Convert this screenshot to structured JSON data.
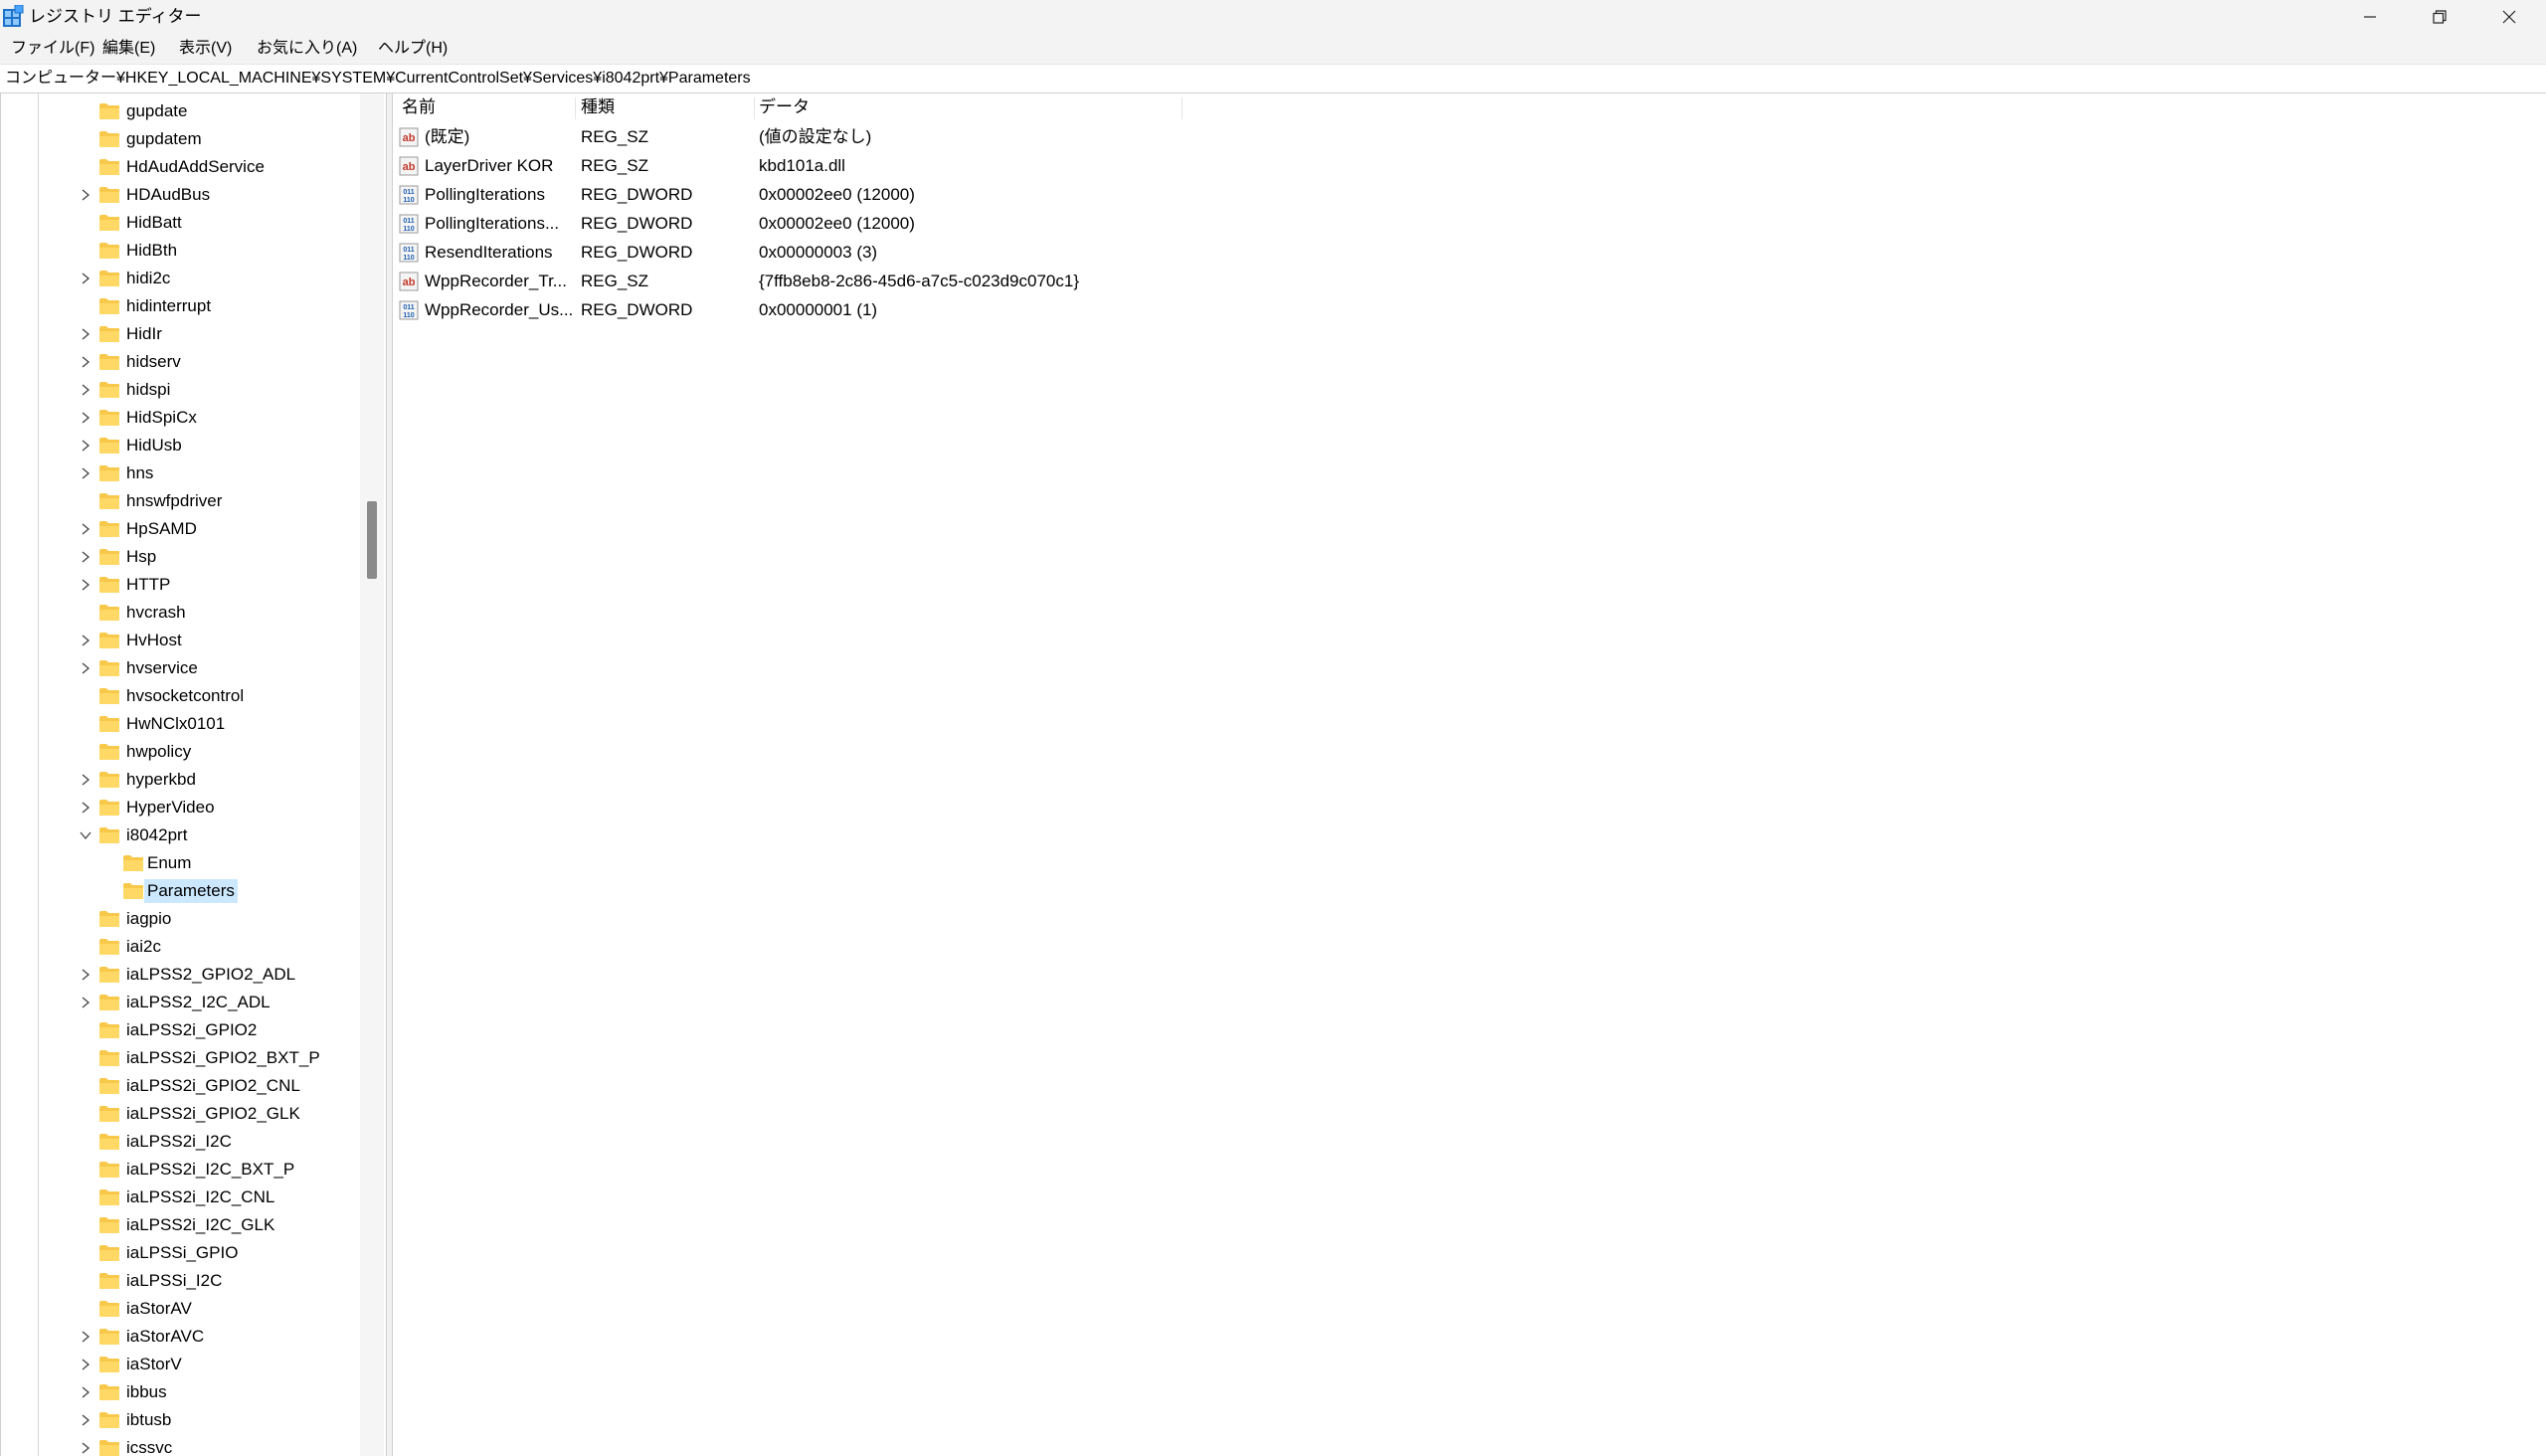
{
  "window": {
    "title": "レジストリ エディター",
    "controls": {
      "minimize": "─",
      "maximize": "❐",
      "close": "✕"
    }
  },
  "menu": [
    "ファイル(F)",
    "編集(E)",
    "表示(V)",
    "お気に入り(A)",
    "ヘルプ(H)"
  ],
  "address": "コンピューター¥HKEY_LOCAL_MACHINE¥SYSTEM¥CurrentControlSet¥Services¥i8042prt¥Parameters",
  "tree": {
    "items": [
      {
        "label": "gupdate",
        "level": 0,
        "chevron": "none"
      },
      {
        "label": "gupdatem",
        "level": 0,
        "chevron": "none"
      },
      {
        "label": "HdAudAddService",
        "level": 0,
        "chevron": "none"
      },
      {
        "label": "HDAudBus",
        "level": 0,
        "chevron": "right"
      },
      {
        "label": "HidBatt",
        "level": 0,
        "chevron": "none"
      },
      {
        "label": "HidBth",
        "level": 0,
        "chevron": "none"
      },
      {
        "label": "hidi2c",
        "level": 0,
        "chevron": "right"
      },
      {
        "label": "hidinterrupt",
        "level": 0,
        "chevron": "none"
      },
      {
        "label": "HidIr",
        "level": 0,
        "chevron": "right"
      },
      {
        "label": "hidserv",
        "level": 0,
        "chevron": "right"
      },
      {
        "label": "hidspi",
        "level": 0,
        "chevron": "right"
      },
      {
        "label": "HidSpiCx",
        "level": 0,
        "chevron": "right"
      },
      {
        "label": "HidUsb",
        "level": 0,
        "chevron": "right"
      },
      {
        "label": "hns",
        "level": 0,
        "chevron": "right"
      },
      {
        "label": "hnswfpdriver",
        "level": 0,
        "chevron": "none"
      },
      {
        "label": "HpSAMD",
        "level": 0,
        "chevron": "right"
      },
      {
        "label": "Hsp",
        "level": 0,
        "chevron": "right"
      },
      {
        "label": "HTTP",
        "level": 0,
        "chevron": "right"
      },
      {
        "label": "hvcrash",
        "level": 0,
        "chevron": "none"
      },
      {
        "label": "HvHost",
        "level": 0,
        "chevron": "right"
      },
      {
        "label": "hvservice",
        "level": 0,
        "chevron": "right"
      },
      {
        "label": "hvsocketcontrol",
        "level": 0,
        "chevron": "none"
      },
      {
        "label": "HwNClx0101",
        "level": 0,
        "chevron": "none"
      },
      {
        "label": "hwpolicy",
        "level": 0,
        "chevron": "none"
      },
      {
        "label": "hyperkbd",
        "level": 0,
        "chevron": "right"
      },
      {
        "label": "HyperVideo",
        "level": 0,
        "chevron": "right"
      },
      {
        "label": "i8042prt",
        "level": 0,
        "chevron": "down"
      },
      {
        "label": "Enum",
        "level": 1,
        "chevron": "none"
      },
      {
        "label": "Parameters",
        "level": 1,
        "chevron": "none",
        "selected": true
      },
      {
        "label": "iagpio",
        "level": 0,
        "chevron": "none"
      },
      {
        "label": "iai2c",
        "level": 0,
        "chevron": "none"
      },
      {
        "label": "iaLPSS2_GPIO2_ADL",
        "level": 0,
        "chevron": "right"
      },
      {
        "label": "iaLPSS2_I2C_ADL",
        "level": 0,
        "chevron": "right"
      },
      {
        "label": "iaLPSS2i_GPIO2",
        "level": 0,
        "chevron": "none"
      },
      {
        "label": "iaLPSS2i_GPIO2_BXT_P",
        "level": 0,
        "chevron": "none"
      },
      {
        "label": "iaLPSS2i_GPIO2_CNL",
        "level": 0,
        "chevron": "none"
      },
      {
        "label": "iaLPSS2i_GPIO2_GLK",
        "level": 0,
        "chevron": "none"
      },
      {
        "label": "iaLPSS2i_I2C",
        "level": 0,
        "chevron": "none"
      },
      {
        "label": "iaLPSS2i_I2C_BXT_P",
        "level": 0,
        "chevron": "none"
      },
      {
        "label": "iaLPSS2i_I2C_CNL",
        "level": 0,
        "chevron": "none"
      },
      {
        "label": "iaLPSS2i_I2C_GLK",
        "level": 0,
        "chevron": "none"
      },
      {
        "label": "iaLPSSi_GPIO",
        "level": 0,
        "chevron": "none"
      },
      {
        "label": "iaLPSSi_I2C",
        "level": 0,
        "chevron": "none"
      },
      {
        "label": "iaStorAV",
        "level": 0,
        "chevron": "none"
      },
      {
        "label": "iaStorAVC",
        "level": 0,
        "chevron": "right"
      },
      {
        "label": "iaStorV",
        "level": 0,
        "chevron": "right"
      },
      {
        "label": "ibbus",
        "level": 0,
        "chevron": "right"
      },
      {
        "label": "ibtusb",
        "level": 0,
        "chevron": "right"
      },
      {
        "label": "icssvc",
        "level": 0,
        "chevron": "right"
      }
    ]
  },
  "list": {
    "columns": [
      "名前",
      "種類",
      "データ"
    ],
    "rows": [
      {
        "icon": "string-value-icon",
        "name": "(既定)",
        "type": "REG_SZ",
        "data": "(値の設定なし)"
      },
      {
        "icon": "string-value-icon",
        "name": "LayerDriver KOR",
        "type": "REG_SZ",
        "data": "kbd101a.dll"
      },
      {
        "icon": "binary-value-icon",
        "name": "PollingIterations",
        "type": "REG_DWORD",
        "data": "0x00002ee0 (12000)"
      },
      {
        "icon": "binary-value-icon",
        "name": "PollingIterations...",
        "type": "REG_DWORD",
        "data": "0x00002ee0 (12000)"
      },
      {
        "icon": "binary-value-icon",
        "name": "ResendIterations",
        "type": "REG_DWORD",
        "data": "0x00000003 (3)"
      },
      {
        "icon": "string-value-icon",
        "name": "WppRecorder_Tr...",
        "type": "REG_SZ",
        "data": "{7ffb8eb8-2c86-45d6-a7c5-c023d9c070c1}"
      },
      {
        "icon": "binary-value-icon",
        "name": "WppRecorder_Us...",
        "type": "REG_DWORD",
        "data": "0x00000001 (1)"
      }
    ]
  },
  "colors": {
    "chrome": "#f3f3f3",
    "selection": "#cce8ff",
    "folder": "#f8c84a"
  }
}
